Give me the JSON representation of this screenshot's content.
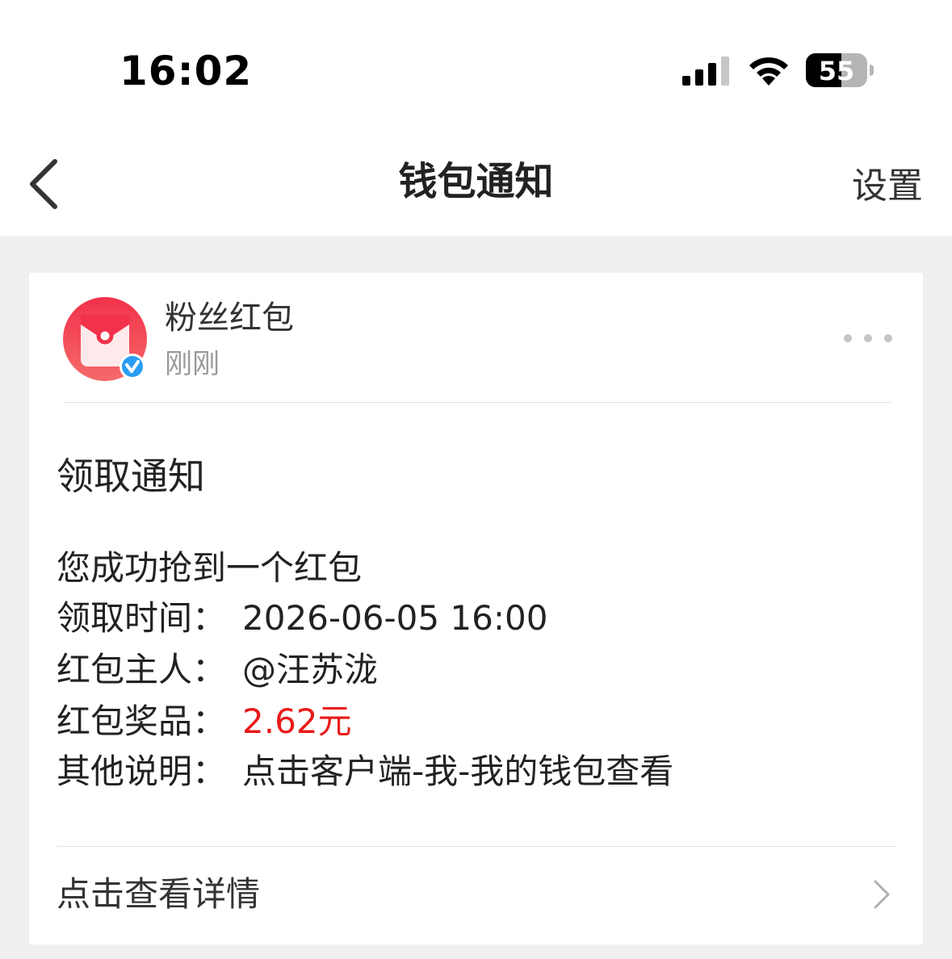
{
  "status_bar": {
    "time": "16:02",
    "battery": "55",
    "icons": [
      "signal-icon",
      "wifi-icon",
      "battery-icon"
    ]
  },
  "nav": {
    "title": "钱包通知",
    "settings_label": "设置",
    "back_icon": "chevron-left-icon"
  },
  "message": {
    "sender_name": "粉丝红包",
    "sender_time": "刚刚",
    "avatar_icon": "red-envelope-icon",
    "verified_badge": "v",
    "title": "领取通知",
    "intro": "您成功抢到一个红包",
    "fields": [
      {
        "label": "领取时间：",
        "value": "2026-06-05 16:00"
      },
      {
        "label": "红包主人：",
        "value": "@汪苏泷"
      },
      {
        "label": "红包奖品：",
        "value": "2.62元"
      },
      {
        "label": "其他说明：",
        "value": "点击客户端-我-我的钱包查看"
      }
    ],
    "details_label": "点击查看详情"
  },
  "colors": {
    "accent_red": "#e91a1a",
    "verified_blue": "#2a9df4",
    "envelope_red": "#f0404f"
  }
}
